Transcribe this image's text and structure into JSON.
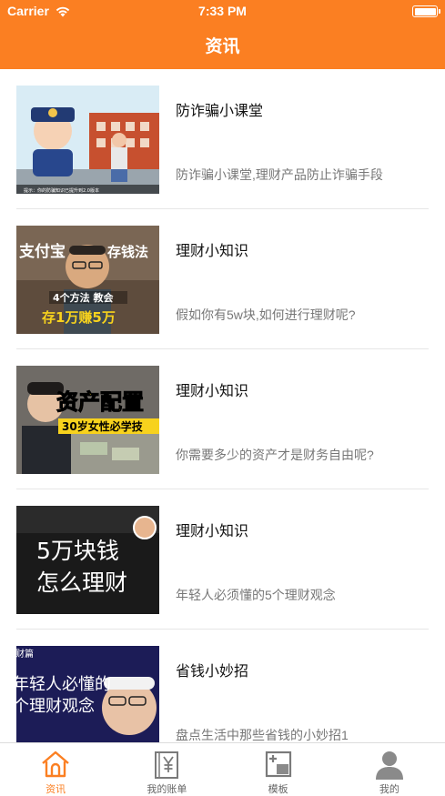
{
  "status_bar": {
    "carrier": "Carrier",
    "time": "7:33 PM"
  },
  "nav": {
    "title": "资讯"
  },
  "colors": {
    "accent": "#fb7f22",
    "divider": "#e6e6e6",
    "subtitle": "#777777"
  },
  "articles": [
    {
      "title": "防诈骗小课堂",
      "subtitle": "防诈骗小课堂,理财产品防止诈骗手段",
      "thumb_caption": "提示：你的防骗知识已提升到2.0版本"
    },
    {
      "title": "理财小知识",
      "subtitle": "假如你有5w块,如何进行理财呢?",
      "thumb_text_left": "支付宝",
      "thumb_text_right": "存钱法",
      "thumb_text_mid": "4个方法 教会",
      "thumb_text_bottom": "存1万赚5万"
    },
    {
      "title": "理财小知识",
      "subtitle": "你需要多少的资产才是财务自由呢?",
      "thumb_text_main": "资产配置",
      "thumb_text_sub": "30岁女性必学技"
    },
    {
      "title": "理财小知识",
      "subtitle": "年轻人必须懂的5个理财观念",
      "thumb_text_line1": "5万块钱",
      "thumb_text_line2": "怎么理财"
    },
    {
      "title": "省钱小妙招",
      "subtitle": "盘点生活中那些省钱的小妙招1",
      "thumb_text_tag": "财篇",
      "thumb_text_line1": "年轻人必懂的",
      "thumb_text_line2": "个理财观念"
    }
  ],
  "tabbar": {
    "tabs": [
      {
        "label": "资讯",
        "icon": "home-icon",
        "active": true
      },
      {
        "label": "我的账单",
        "icon": "bill-icon",
        "active": false
      },
      {
        "label": "模板",
        "icon": "template-icon",
        "active": false
      },
      {
        "label": "我的",
        "icon": "profile-icon",
        "active": false
      }
    ]
  }
}
